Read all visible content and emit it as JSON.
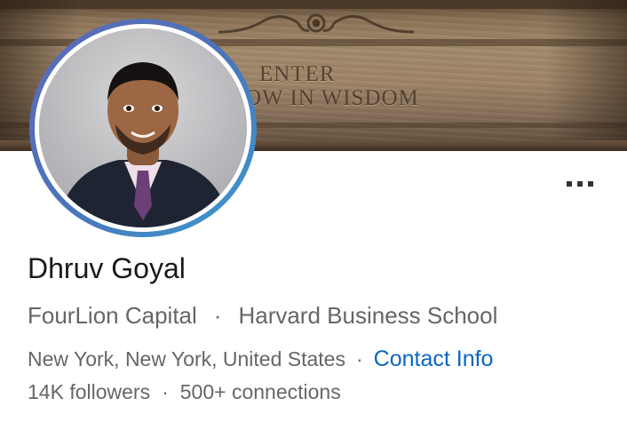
{
  "banner": {
    "engraving_line1": "ENTER",
    "engraving_line2": "OW IN WISDOM"
  },
  "profile": {
    "name": "Dhruv Goyal",
    "company": "FourLion Capital",
    "school": "Harvard Business School",
    "location": "New York, New York, United States",
    "contact_label": "Contact Info",
    "followers": "14K followers",
    "connections": "500+ connections",
    "separator": "·"
  },
  "actions": {
    "more_icon": "more-horizontal-icon"
  },
  "colors": {
    "link": "#0a66c2",
    "name_text": "#191919",
    "secondary_text": "#666666",
    "avatar_ring_start": "#5f6ab8",
    "avatar_ring_end": "#3c9ad0"
  }
}
